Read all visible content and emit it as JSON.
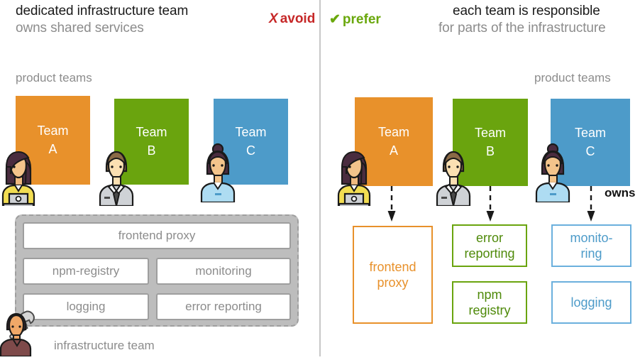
{
  "colors": {
    "orange": "#e8912b",
    "green": "#6aa40e",
    "blue": "#4d9bc9",
    "gray_fill": "#bdbdbd",
    "gray_border": "#9e9e9e",
    "gray_text": "#8c8c8c",
    "avoid_red": "#c62828",
    "prefer_green": "#6aa80c",
    "divider": "#c7c7c7"
  },
  "left_panel": {
    "header": {
      "title": "dedicated infrastructure team",
      "subtitle": "owns shared services"
    },
    "verdict": {
      "mark": "X",
      "label": "avoid"
    },
    "product_teams_caption": "product teams",
    "teams": [
      {
        "line1": "Team",
        "line2": "A",
        "color": "#e8912b",
        "avatar": "avatar-woman-laptop"
      },
      {
        "line1": "Team",
        "line2": "B",
        "color": "#6aa40e",
        "avatar": "avatar-man-tie"
      },
      {
        "line1": "Team",
        "line2": "C",
        "color": "#4d9bc9",
        "avatar": "avatar-woman-bun"
      }
    ],
    "infrastructure": {
      "caption": "infrastructure team",
      "avatar": "avatar-engineer-wrench",
      "services": [
        {
          "label": "frontend proxy"
        },
        {
          "label": "npm-registry"
        },
        {
          "label": "monitoring"
        },
        {
          "label": "logging"
        },
        {
          "label": "error reporting"
        }
      ]
    }
  },
  "right_panel": {
    "header": {
      "title": "each team is responsible",
      "subtitle": "for parts of the infrastructure"
    },
    "verdict": {
      "mark": "✔",
      "label": "prefer"
    },
    "product_teams_caption": "product teams",
    "owns_label": "owns",
    "teams": [
      {
        "line1": "Team",
        "line2": "A",
        "color": "#e8912b",
        "avatar": "avatar-woman-laptop",
        "owned": [
          {
            "lines": [
              "frontend",
              "proxy"
            ]
          }
        ]
      },
      {
        "line1": "Team",
        "line2": "B",
        "color": "#6aa40e",
        "avatar": "avatar-man-tie",
        "owned": [
          {
            "lines": [
              "error",
              "reporting"
            ]
          },
          {
            "lines": [
              "npm",
              "registry"
            ]
          }
        ]
      },
      {
        "line1": "Team",
        "line2": "C",
        "color": "#4d9bc9",
        "avatar": "avatar-woman-bun",
        "owned": [
          {
            "lines": [
              "monito-",
              "ring"
            ]
          },
          {
            "lines": [
              "logging"
            ]
          }
        ]
      }
    ]
  }
}
